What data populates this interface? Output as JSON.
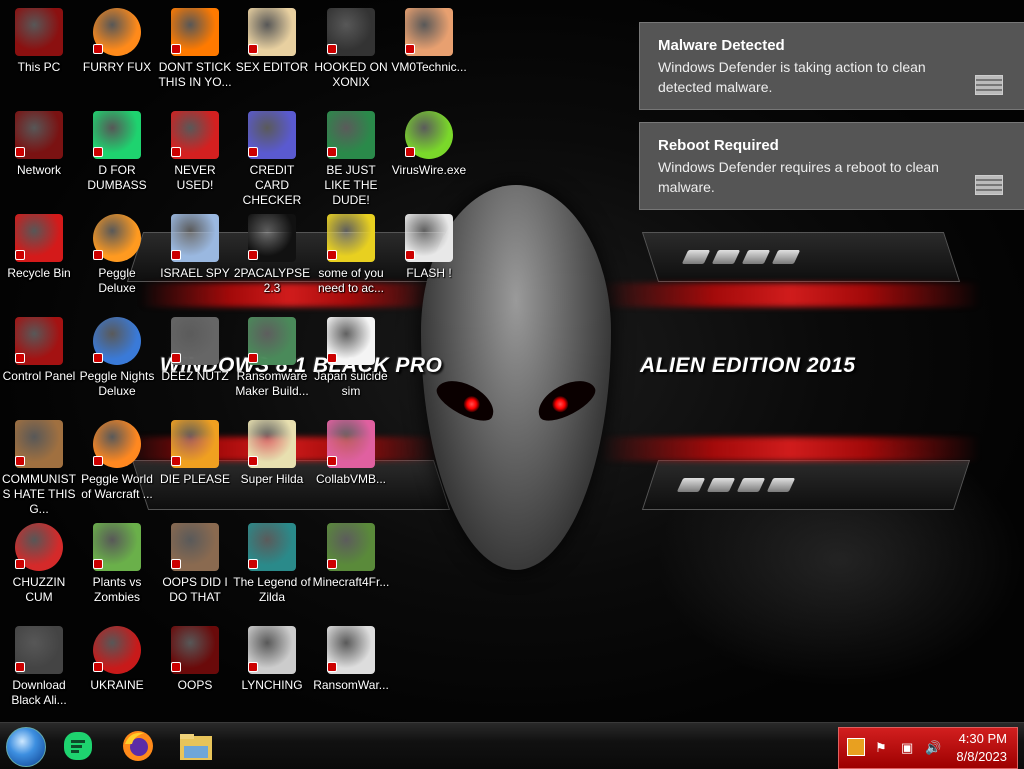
{
  "wallpaper": {
    "left_text": "WINDOWS 8.1 BLACK PRO",
    "right_text": "ALIEN EDITION 2015"
  },
  "desktop": {
    "columns": [
      {
        "icons": [
          {
            "label": "This PC",
            "icon": "computer-icon"
          },
          {
            "label": "Network",
            "icon": "network-icon"
          },
          {
            "label": "Recycle Bin",
            "icon": "recycle-bin-icon"
          },
          {
            "label": "Control Panel",
            "icon": "control-panel-icon"
          },
          {
            "label": "COMMUNISTS HATE THIS G...",
            "icon": "money-bag-icon"
          },
          {
            "label": "CHUZZIN CUM",
            "icon": "chuzzle-icon"
          },
          {
            "label": "Download Black Ali...",
            "icon": "alien-disc-icon"
          }
        ]
      },
      {
        "icons": [
          {
            "label": "FURRY FUX",
            "icon": "firefox-icon"
          },
          {
            "label": "D FOR DUMBASS",
            "icon": "d-app-icon"
          },
          {
            "label": "Peggle Deluxe",
            "icon": "peggle-icon"
          },
          {
            "label": "Peggle Nights Deluxe",
            "icon": "peggle-nights-icon"
          },
          {
            "label": "Peggle World of Warcraft ...",
            "icon": "peggle-wow-icon"
          },
          {
            "label": "Plants vs Zombies",
            "icon": "plants-icon"
          },
          {
            "label": "UKRAINE",
            "icon": "radiation-icon"
          }
        ]
      },
      {
        "icons": [
          {
            "label": "DONT STICK THIS IN YO...",
            "icon": "vlc-cone-icon"
          },
          {
            "label": "NEVER USED!",
            "icon": "devcpp-icon"
          },
          {
            "label": "ISRAEL SPY",
            "icon": "remote-tool-icon"
          },
          {
            "label": "DEEZ NUTZ",
            "icon": "stacked-windows-icon"
          },
          {
            "label": "DIE PLEASE",
            "icon": "de-icon"
          },
          {
            "label": "OOPS DID I DO THAT",
            "icon": "portrait-icon"
          },
          {
            "label": "OOPS",
            "icon": "red-device-icon"
          }
        ]
      },
      {
        "icons": [
          {
            "label": "SEX EDITOR",
            "icon": "hxd-icon"
          },
          {
            "label": "CREDIT CARD CHECKER",
            "icon": "credit-card-icon"
          },
          {
            "label": "2PACALYPSE 2.3",
            "icon": "terminal-icon"
          },
          {
            "label": "Ransomware Maker Build...",
            "icon": "builder-icon"
          },
          {
            "label": "Super Hilda",
            "icon": "pixel-game-icon"
          },
          {
            "label": "The Legend of Zilda",
            "icon": "zelda-icon"
          },
          {
            "label": "LYNCHING",
            "icon": "knot-icon"
          }
        ]
      },
      {
        "icons": [
          {
            "label": "HOOKED ON XONIX",
            "icon": "xonix-icon"
          },
          {
            "label": "BE JUST LIKE THE DUDE!",
            "icon": "elf-icon"
          },
          {
            "label": "some of you need to ac...",
            "icon": "beaver-icon"
          },
          {
            "label": "Japan suicide sim",
            "icon": "document-icon"
          },
          {
            "label": "CollabVMB...",
            "icon": "collabvm-icon"
          },
          {
            "label": "Minecraft4Fr...",
            "icon": "grass-block-icon"
          },
          {
            "label": "RansomWar...",
            "icon": "skull-icon"
          }
        ]
      },
      {
        "icons": [
          {
            "label": "VM0Technic...",
            "icon": "doctor-icon"
          },
          {
            "label": "VirusWire.exe",
            "icon": "lime-icon"
          },
          {
            "label": "FLASH !",
            "icon": "flash-doc-icon"
          }
        ]
      }
    ]
  },
  "notifications": [
    {
      "title": "Malware Detected",
      "body": "Windows Defender is taking action to clean detected malware.",
      "icon": "defender-wall-icon"
    },
    {
      "title": "Reboot Required",
      "body": "Windows Defender requires a reboot to clean malware.",
      "icon": "defender-wall-icon"
    }
  ],
  "taskbar": {
    "pinned": [
      {
        "name": "start-orb",
        "icon": "start-orb-icon"
      },
      {
        "name": "taskbar-d-app",
        "icon": "d-app-icon"
      },
      {
        "name": "taskbar-firefox",
        "icon": "firefox-icon"
      },
      {
        "name": "taskbar-explorer",
        "icon": "folder-icon"
      }
    ],
    "tray": {
      "time": "4:30 PM",
      "date": "8/8/2023",
      "icons": [
        "defender-tray-icon",
        "flag-icon",
        "network-tray-icon",
        "speaker-icon"
      ]
    }
  },
  "colors": {
    "toast_bg": "#555555",
    "tray_red": "#c41616",
    "wallpaper_red": "#d01818"
  }
}
